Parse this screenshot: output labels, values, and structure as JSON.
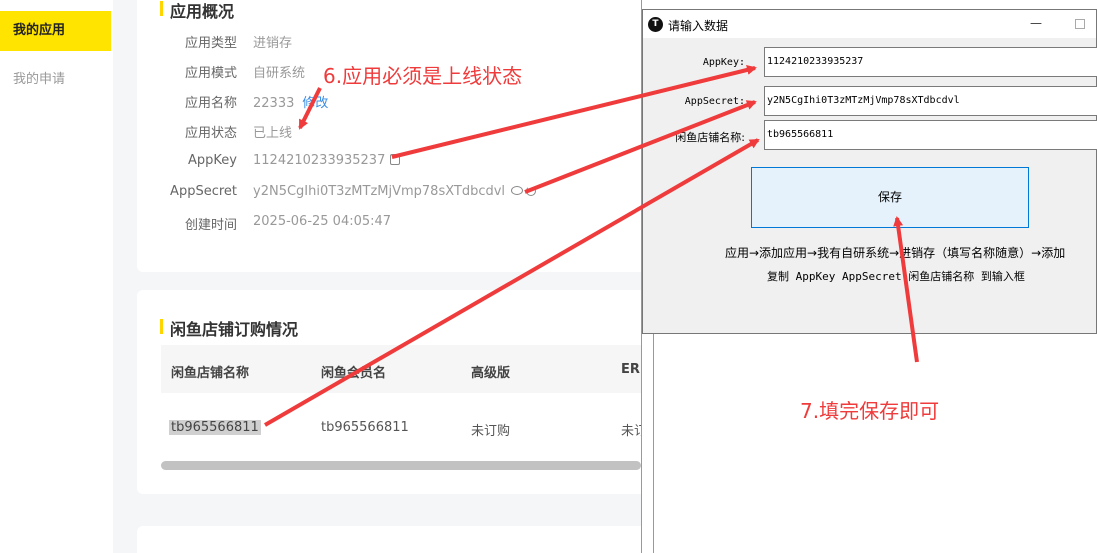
{
  "sidebar": {
    "items": [
      {
        "label": "我的应用"
      },
      {
        "label": "我的申请"
      }
    ]
  },
  "overview": {
    "title": "应用概况",
    "rows": [
      {
        "label": "应用类型",
        "value": "进销存"
      },
      {
        "label": "应用模式",
        "value": "自研系统"
      },
      {
        "label": "应用名称",
        "value": "22333",
        "link": "修改"
      },
      {
        "label": "应用状态",
        "value": "已上线"
      },
      {
        "label": "AppKey",
        "value": "1124210233935237"
      },
      {
        "label": "AppSecret",
        "value": "y2N5CgIhi0T3zMTzMjVmp78sXTdbcdvl"
      },
      {
        "label": "创建时间",
        "value": "2025-06-25 04:05:47"
      }
    ]
  },
  "orders": {
    "title": "闲鱼店铺订购情况",
    "columns": [
      "闲鱼店铺名称",
      "闲鱼会员名",
      "高级版",
      "ER"
    ],
    "rows": [
      [
        "tb965566811",
        "tb965566811",
        "未订购",
        "未订"
      ]
    ]
  },
  "dialog": {
    "title": "请输入数据",
    "fields": [
      {
        "label": "AppKey:",
        "value": "1124210233935237"
      },
      {
        "label": "AppSecret:",
        "value": "y2N5CgIhi0T3zMTzMjVmp78sXTdbcdvl"
      },
      {
        "label": "闲鱼店铺名称:",
        "value": "tb965566811"
      }
    ],
    "save_label": "保存",
    "hint_line1": "应用→添加应用→我有自研系统→进销存（填写名称随意）→添加",
    "hint_line2": "复制 AppKey  AppSecret 闲鱼店铺名称 到输入框"
  },
  "annotations": {
    "step6": "6.应用必须是上线状态",
    "step7": "7.填完保存即可",
    "color": "#ef3b3b"
  },
  "colors": {
    "accent_yellow": "#ffe400",
    "link_blue": "#3a8ee6",
    "button_border": "#0078d7"
  }
}
